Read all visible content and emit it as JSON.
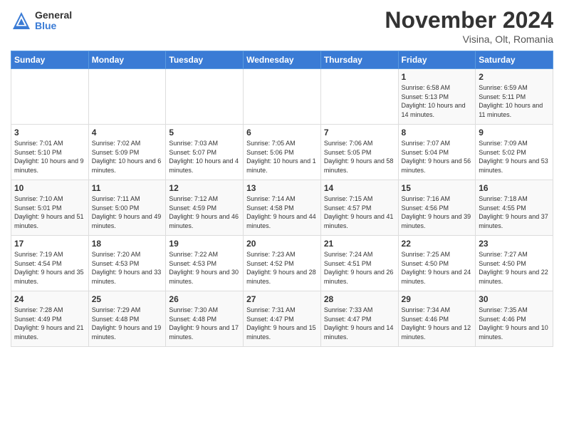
{
  "header": {
    "logo_general": "General",
    "logo_blue": "Blue",
    "title": "November 2024",
    "location": "Visina, Olt, Romania"
  },
  "days_of_week": [
    "Sunday",
    "Monday",
    "Tuesday",
    "Wednesday",
    "Thursday",
    "Friday",
    "Saturday"
  ],
  "weeks": [
    [
      {
        "day": "",
        "info": ""
      },
      {
        "day": "",
        "info": ""
      },
      {
        "day": "",
        "info": ""
      },
      {
        "day": "",
        "info": ""
      },
      {
        "day": "",
        "info": ""
      },
      {
        "day": "1",
        "info": "Sunrise: 6:58 AM\nSunset: 5:13 PM\nDaylight: 10 hours and 14 minutes."
      },
      {
        "day": "2",
        "info": "Sunrise: 6:59 AM\nSunset: 5:11 PM\nDaylight: 10 hours and 11 minutes."
      }
    ],
    [
      {
        "day": "3",
        "info": "Sunrise: 7:01 AM\nSunset: 5:10 PM\nDaylight: 10 hours and 9 minutes."
      },
      {
        "day": "4",
        "info": "Sunrise: 7:02 AM\nSunset: 5:09 PM\nDaylight: 10 hours and 6 minutes."
      },
      {
        "day": "5",
        "info": "Sunrise: 7:03 AM\nSunset: 5:07 PM\nDaylight: 10 hours and 4 minutes."
      },
      {
        "day": "6",
        "info": "Sunrise: 7:05 AM\nSunset: 5:06 PM\nDaylight: 10 hours and 1 minute."
      },
      {
        "day": "7",
        "info": "Sunrise: 7:06 AM\nSunset: 5:05 PM\nDaylight: 9 hours and 58 minutes."
      },
      {
        "day": "8",
        "info": "Sunrise: 7:07 AM\nSunset: 5:04 PM\nDaylight: 9 hours and 56 minutes."
      },
      {
        "day": "9",
        "info": "Sunrise: 7:09 AM\nSunset: 5:02 PM\nDaylight: 9 hours and 53 minutes."
      }
    ],
    [
      {
        "day": "10",
        "info": "Sunrise: 7:10 AM\nSunset: 5:01 PM\nDaylight: 9 hours and 51 minutes."
      },
      {
        "day": "11",
        "info": "Sunrise: 7:11 AM\nSunset: 5:00 PM\nDaylight: 9 hours and 49 minutes."
      },
      {
        "day": "12",
        "info": "Sunrise: 7:12 AM\nSunset: 4:59 PM\nDaylight: 9 hours and 46 minutes."
      },
      {
        "day": "13",
        "info": "Sunrise: 7:14 AM\nSunset: 4:58 PM\nDaylight: 9 hours and 44 minutes."
      },
      {
        "day": "14",
        "info": "Sunrise: 7:15 AM\nSunset: 4:57 PM\nDaylight: 9 hours and 41 minutes."
      },
      {
        "day": "15",
        "info": "Sunrise: 7:16 AM\nSunset: 4:56 PM\nDaylight: 9 hours and 39 minutes."
      },
      {
        "day": "16",
        "info": "Sunrise: 7:18 AM\nSunset: 4:55 PM\nDaylight: 9 hours and 37 minutes."
      }
    ],
    [
      {
        "day": "17",
        "info": "Sunrise: 7:19 AM\nSunset: 4:54 PM\nDaylight: 9 hours and 35 minutes."
      },
      {
        "day": "18",
        "info": "Sunrise: 7:20 AM\nSunset: 4:53 PM\nDaylight: 9 hours and 33 minutes."
      },
      {
        "day": "19",
        "info": "Sunrise: 7:22 AM\nSunset: 4:53 PM\nDaylight: 9 hours and 30 minutes."
      },
      {
        "day": "20",
        "info": "Sunrise: 7:23 AM\nSunset: 4:52 PM\nDaylight: 9 hours and 28 minutes."
      },
      {
        "day": "21",
        "info": "Sunrise: 7:24 AM\nSunset: 4:51 PM\nDaylight: 9 hours and 26 minutes."
      },
      {
        "day": "22",
        "info": "Sunrise: 7:25 AM\nSunset: 4:50 PM\nDaylight: 9 hours and 24 minutes."
      },
      {
        "day": "23",
        "info": "Sunrise: 7:27 AM\nSunset: 4:50 PM\nDaylight: 9 hours and 22 minutes."
      }
    ],
    [
      {
        "day": "24",
        "info": "Sunrise: 7:28 AM\nSunset: 4:49 PM\nDaylight: 9 hours and 21 minutes."
      },
      {
        "day": "25",
        "info": "Sunrise: 7:29 AM\nSunset: 4:48 PM\nDaylight: 9 hours and 19 minutes."
      },
      {
        "day": "26",
        "info": "Sunrise: 7:30 AM\nSunset: 4:48 PM\nDaylight: 9 hours and 17 minutes."
      },
      {
        "day": "27",
        "info": "Sunrise: 7:31 AM\nSunset: 4:47 PM\nDaylight: 9 hours and 15 minutes."
      },
      {
        "day": "28",
        "info": "Sunrise: 7:33 AM\nSunset: 4:47 PM\nDaylight: 9 hours and 14 minutes."
      },
      {
        "day": "29",
        "info": "Sunrise: 7:34 AM\nSunset: 4:46 PM\nDaylight: 9 hours and 12 minutes."
      },
      {
        "day": "30",
        "info": "Sunrise: 7:35 AM\nSunset: 4:46 PM\nDaylight: 9 hours and 10 minutes."
      }
    ]
  ]
}
